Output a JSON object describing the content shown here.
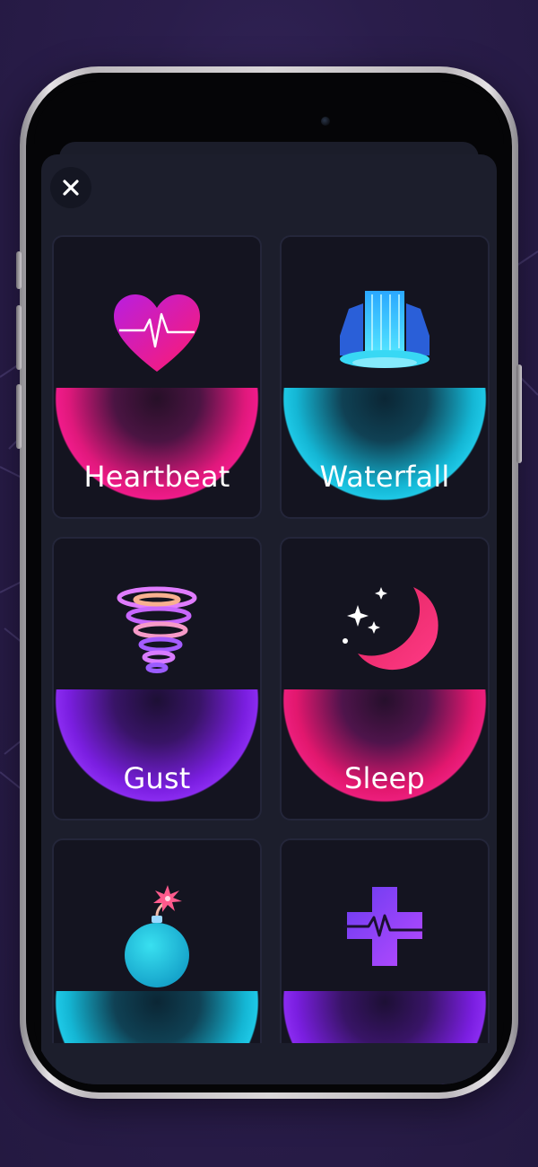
{
  "close_button": {
    "icon": "close-icon"
  },
  "cards": [
    {
      "label": "Heartbeat",
      "icon": "heart-pulse-icon",
      "glow": "pink"
    },
    {
      "label": "Waterfall",
      "icon": "waterfall-icon",
      "glow": "cyan"
    },
    {
      "label": "Gust",
      "icon": "tornado-icon",
      "glow": "purple"
    },
    {
      "label": "Sleep",
      "icon": "moon-stars-icon",
      "glow": "pinkpurple"
    },
    {
      "label": "",
      "icon": "bomb-icon",
      "glow": "cyan"
    },
    {
      "label": "",
      "icon": "medical-cross-icon",
      "glow": "purple"
    }
  ],
  "colors": {
    "background": "#2a1d4b",
    "sheet": "#1c1e2c",
    "card": "#141420",
    "pink": "#f01b8a",
    "cyan": "#1ec8e6",
    "purple": "#8a2bf0"
  }
}
